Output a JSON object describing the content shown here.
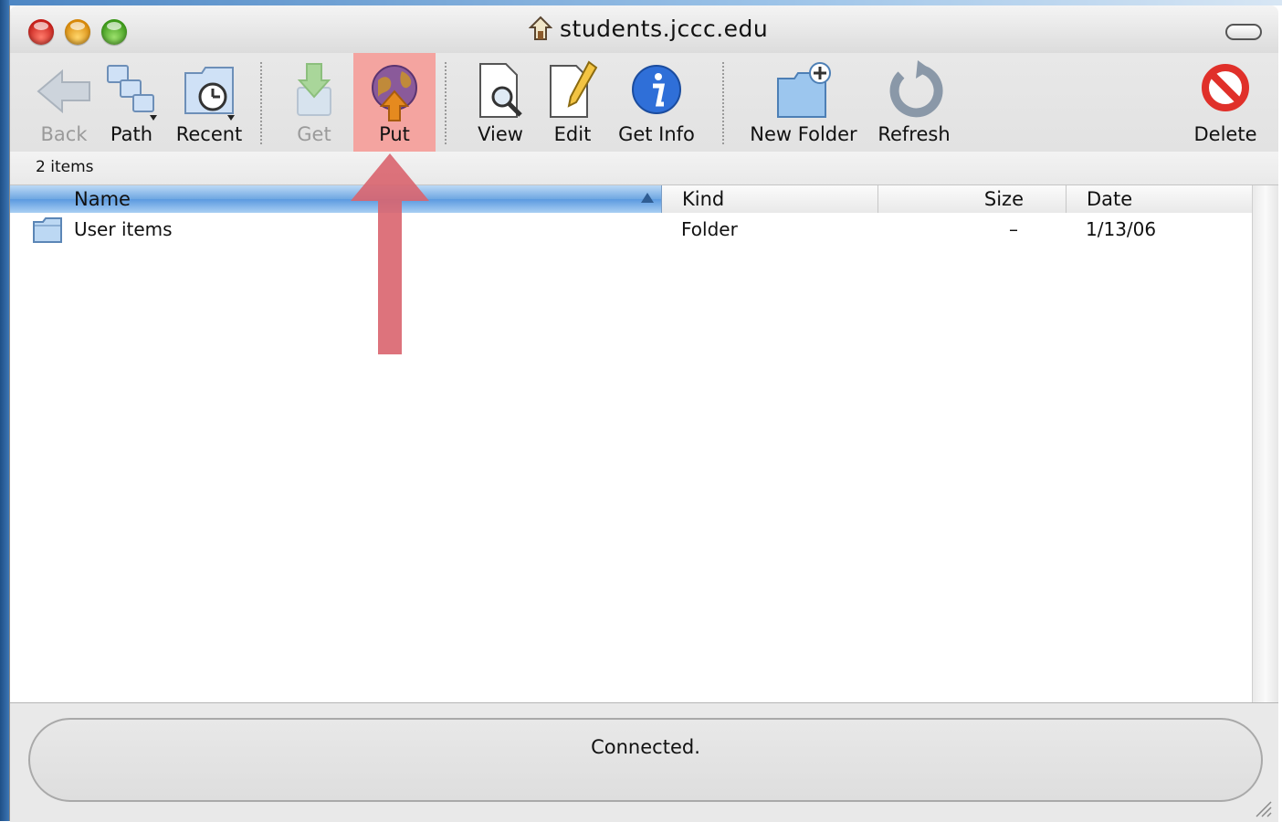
{
  "window": {
    "title": "students.jccc.edu"
  },
  "toolbar": {
    "back_label": "Back",
    "path_label": "Path",
    "recent_label": "Recent",
    "get_label": "Get",
    "put_label": "Put",
    "view_label": "View",
    "edit_label": "Edit",
    "get_info_label": "Get Info",
    "new_folder_label": "New Folder",
    "refresh_label": "Refresh",
    "delete_label": "Delete",
    "icons": {
      "back": "back-arrow-icon",
      "path": "path-folders-icon",
      "recent": "recent-clock-folder-icon",
      "get": "download-icon",
      "put": "globe-upload-icon",
      "view": "document-magnifier-icon",
      "edit": "document-pencil-icon",
      "get_info": "info-icon",
      "new_folder": "new-folder-icon",
      "refresh": "refresh-icon",
      "delete": "delete-icon"
    }
  },
  "status_bar": {
    "item_count": "2 items",
    "connection_status": "Connected."
  },
  "table": {
    "columns": [
      {
        "key": "name",
        "label": "Name",
        "sorted": true,
        "sort_direction": "ascending"
      },
      {
        "key": "kind",
        "label": "Kind"
      },
      {
        "key": "size",
        "label": "Size"
      },
      {
        "key": "date",
        "label": "Date"
      }
    ],
    "rows": [
      {
        "name": "User items",
        "kind": "Folder",
        "size": "–",
        "date": "1/13/06",
        "icon": "folder-icon"
      }
    ]
  },
  "colors": {
    "highlight_button_bg": "#f4a4a0",
    "annotation_arrow": "#d9646e",
    "sorted_header": "#5b9ae0"
  }
}
